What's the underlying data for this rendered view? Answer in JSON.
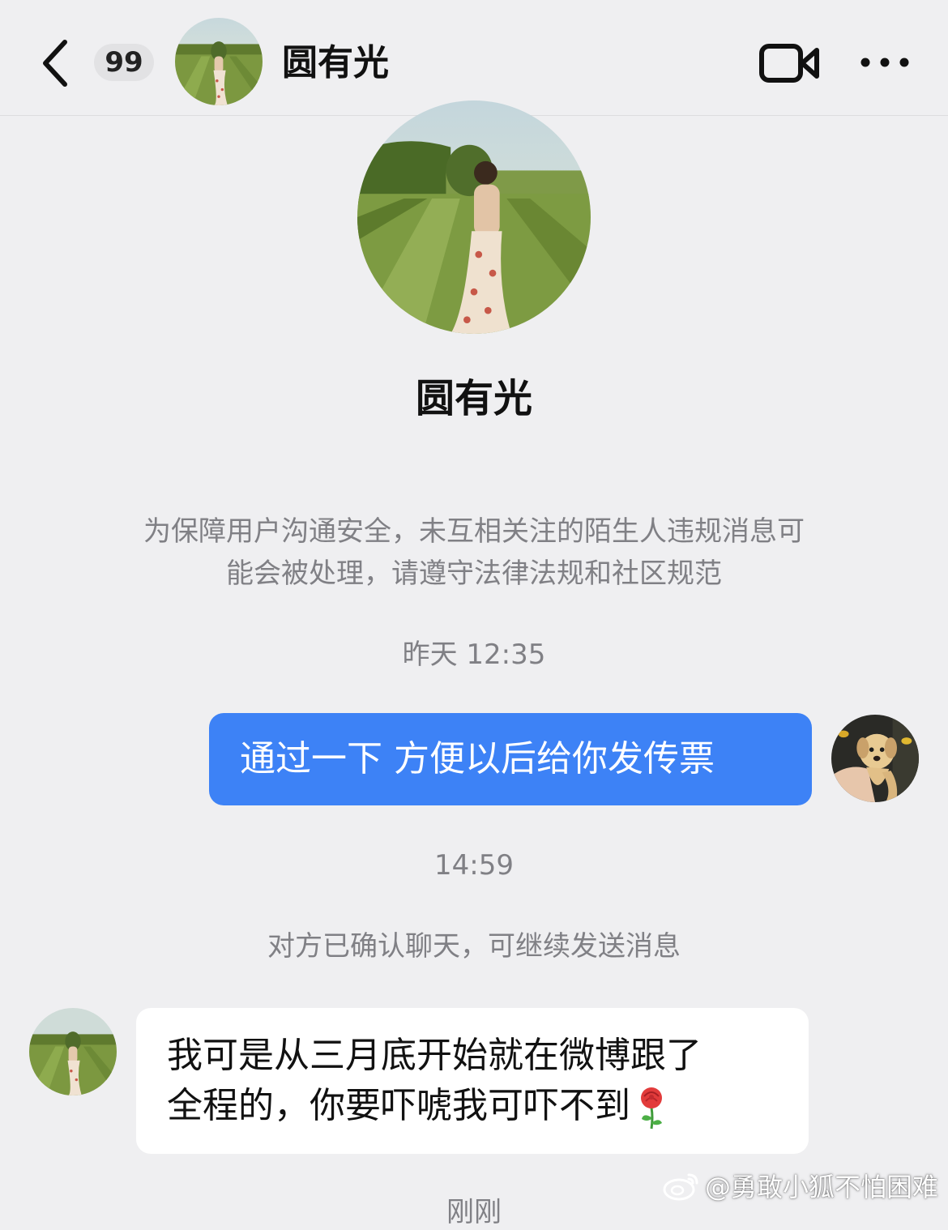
{
  "header": {
    "back_icon": "chevron-left-icon",
    "unread_badge": "99",
    "title": "圆有光",
    "video_icon": "video-call-icon",
    "more_icon": "more-horizontal-icon"
  },
  "profile": {
    "name": "圆有光"
  },
  "notice": {
    "line1": "为保障用户沟通安全，未互相关注的陌生人违规消息可",
    "line2": "能会被处理，请遵守法律法规和社区规范"
  },
  "messages": {
    "ts1": "昨天 12:35",
    "outgoing": "通过一下 方便以后给你发传票",
    "ts2": "14:59",
    "system": "对方已确认聊天，可继续发送消息",
    "incoming_line1": "我可是从三月底开始就在微博跟了",
    "incoming_line2": "全程的，你要吓唬我可吓不到",
    "incoming_emoji": "rose-icon",
    "ts3": "刚刚"
  },
  "watermark": {
    "text": "@勇敢小狐不怕困难"
  },
  "colors": {
    "background": "#efeff1",
    "outgoing_bubble": "#3d82f6",
    "incoming_bubble": "#ffffff",
    "meta_text": "#808085"
  }
}
